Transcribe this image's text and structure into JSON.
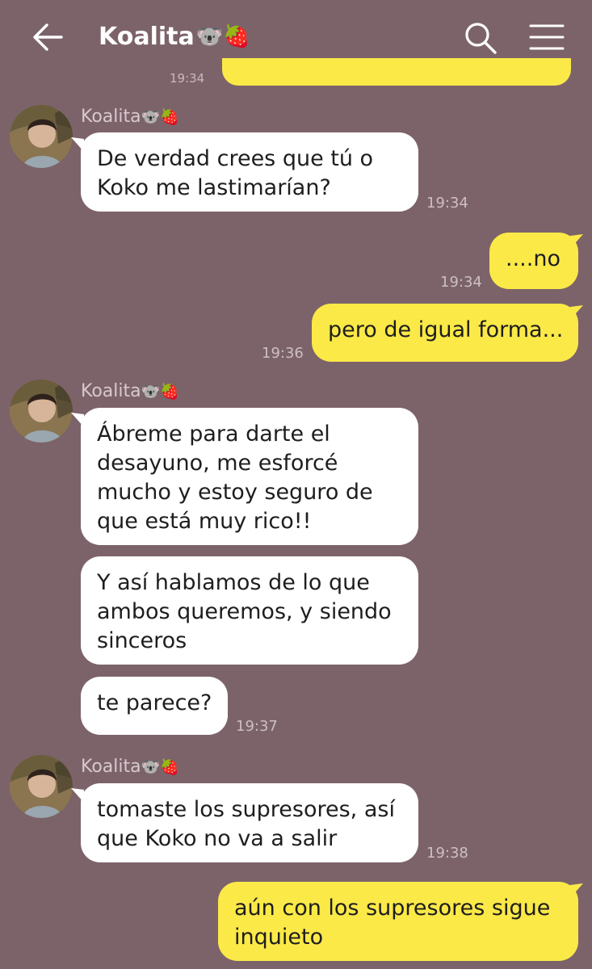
{
  "header": {
    "title": "Koalita",
    "title_emojis": "🐨🍓",
    "back_icon": "arrow-left-icon",
    "search_icon": "search-icon",
    "menu_icon": "hamburger-menu-icon"
  },
  "colors": {
    "background": "#7c636a",
    "incoming_bubble": "#ffffff",
    "outgoing_bubble": "#fbe948",
    "timestamp": "#cdbfc3"
  },
  "messages": {
    "stub_time": "19:34",
    "g1": {
      "sender": "Koalita",
      "sender_emojis": "🐨🍓",
      "text": "De verdad crees que tú o Koko me lastimarían?",
      "time": "19:34"
    },
    "o1": {
      "text": "....no",
      "time": "19:34"
    },
    "o2": {
      "text": "pero de igual forma...",
      "time": "19:36"
    },
    "g2": {
      "sender": "Koalita",
      "sender_emojis": "🐨🍓",
      "m1": "Ábreme para darte el desayuno, me esforcé mucho y estoy seguro de que está muy rico!!",
      "m2": "Y así hablamos de lo que ambos queremos, y siendo sinceros",
      "m3": "te parece?",
      "time": "19:37"
    },
    "g3": {
      "sender": "Koalita",
      "sender_emojis": "🐨🍓",
      "text": "tomaste los supresores, así que Koko no va a salir",
      "time": "19:38"
    },
    "o3": {
      "text": "aún con los supresores sigue inquieto"
    }
  }
}
